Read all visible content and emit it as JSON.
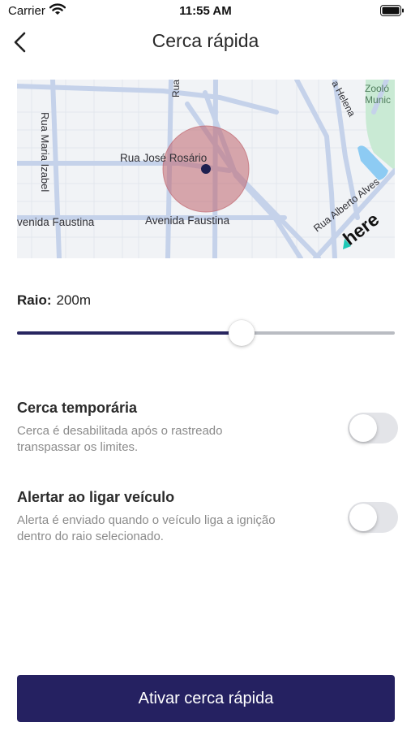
{
  "status_bar": {
    "carrier": "Carrier",
    "time": "11:55 AM",
    "icons": [
      "wifi-icon",
      "battery-icon"
    ]
  },
  "nav": {
    "back_icon": "chevron-left-icon",
    "title": "Cerca rápida"
  },
  "map": {
    "streets": {
      "rua_jose_rosario": "Rua José Rosário",
      "rua_maria_izabel": "Rua Maria Izabel",
      "avenida_faustina_left": "venida Faustina",
      "avenida_faustina_right": "Avenida Faustina",
      "rua_alberto_alves": "Rua Alberto Alves",
      "rua_helena": "a Helena",
      "rua_top": "Rua"
    },
    "poi_label_1": "Zooló",
    "poi_label_2": "Munic",
    "logo": "here",
    "marker_icon": "location-dot-icon",
    "colors": {
      "fence_fill": "#c0656d",
      "marker": "#1e2050",
      "park": "#c9ead4",
      "water": "#8dcbf3"
    }
  },
  "radius": {
    "label": "Raio:",
    "value": "200m",
    "slider_fraction": 0.595
  },
  "options": [
    {
      "title": "Cerca temporária",
      "description": "Cerca é desabilitada após o rastreado transpassar os limites.",
      "enabled": false
    },
    {
      "title": "Alertar ao ligar veículo",
      "description": "Alerta é enviado quando o veículo liga a ignição dentro do raio selecionado.",
      "enabled": false
    }
  ],
  "primary_button": {
    "label": "Ativar cerca rápida"
  },
  "colors": {
    "primary": "#252161",
    "slider_track": "#b9bcc2",
    "toggle_off": "#e3e4e8"
  }
}
